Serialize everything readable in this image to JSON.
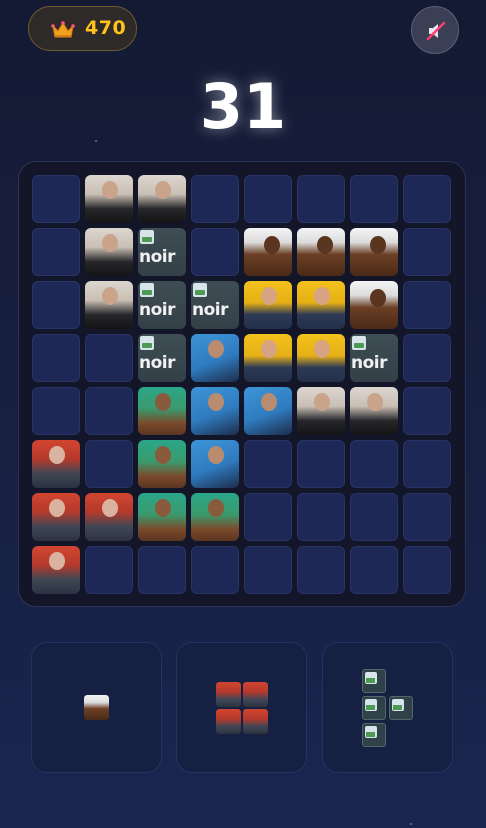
{
  "header": {
    "high_score": "470",
    "crown_icon": "crown-icon",
    "mute_icon": "speaker-muted-icon"
  },
  "current_score": "31",
  "board": {
    "rows": 8,
    "cols": 8,
    "cells": [
      [
        "",
        "man",
        "man",
        "",
        "",
        "",
        "",
        ""
      ],
      [
        "",
        "man",
        "noir",
        "",
        "horse",
        "horse",
        "horse",
        ""
      ],
      [
        "",
        "man",
        "noir",
        "noir",
        "gold",
        "gold",
        "horse",
        ""
      ],
      [
        "",
        "",
        "noir",
        "blue",
        "gold",
        "gold",
        "noir",
        ""
      ],
      [
        "",
        "",
        "green",
        "blue",
        "blue",
        "man",
        "man",
        ""
      ],
      [
        "red",
        "",
        "green",
        "blue",
        "",
        "",
        "",
        ""
      ],
      [
        "red",
        "red",
        "green",
        "green",
        "",
        "",
        "",
        ""
      ],
      [
        "red",
        "",
        "",
        "",
        "",
        "",
        "",
        ""
      ]
    ],
    "noir_label": "noir"
  },
  "pieces": [
    {
      "name": "single-horse-piece",
      "tile": "horse"
    },
    {
      "name": "square-red-piece",
      "tile": "red"
    },
    {
      "name": "t-broken-image-piece",
      "tile": "broken-image"
    }
  ],
  "colors": {
    "score_gold": "#ffc21a",
    "cell_empty": "#1d2856",
    "board_bg": "#121628"
  }
}
